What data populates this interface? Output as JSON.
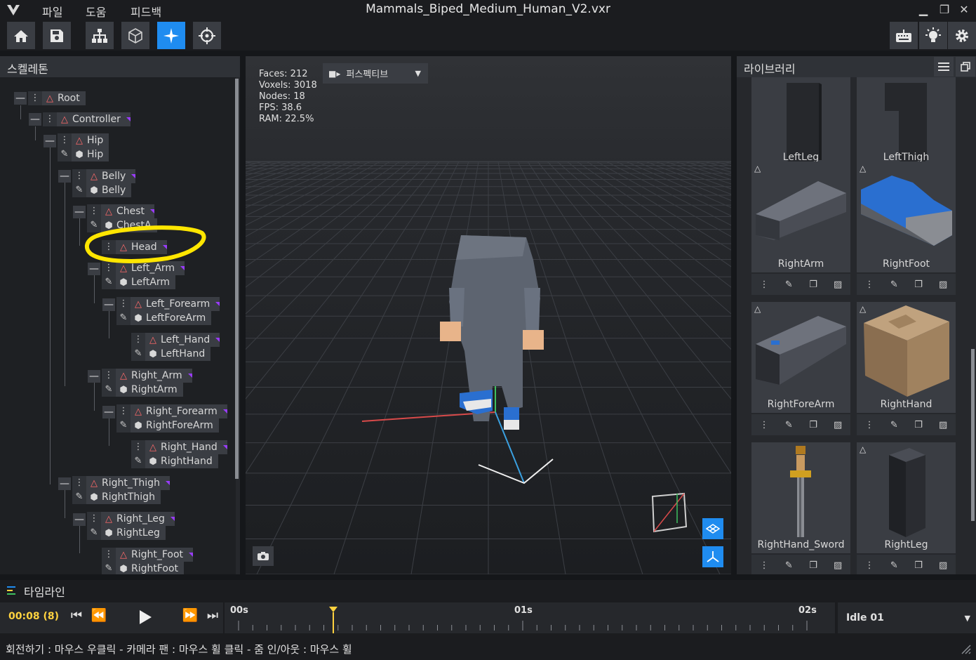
{
  "app": {
    "title": "Mammals_Biped_Medium_Human_V2.vxr",
    "menu": [
      "파일",
      "도움",
      "피드백"
    ]
  },
  "toolbar": {
    "left_icons": [
      "home-icon",
      "save-icon",
      "hierarchy-icon",
      "cube-icon",
      "sparkle-icon",
      "crosshair-icon"
    ],
    "active": "sparkle-icon",
    "right_icons": [
      "keyboard-icon",
      "lightbulb-icon",
      "gear-icon"
    ]
  },
  "skeleton": {
    "title": "스켈레톤",
    "nodes": [
      {
        "bone": "Root"
      },
      {
        "bone": "Controller"
      },
      {
        "bone": "Hip",
        "voxel": "Hip"
      },
      {
        "bone": "Belly",
        "voxel": "Belly"
      },
      {
        "bone": "Chest",
        "voxel": "ChestA"
      },
      {
        "bone": "Head"
      },
      {
        "bone": "Left_Arm",
        "voxel": "LeftArm"
      },
      {
        "bone": "Left_Forearm",
        "voxel": "LeftForeArm"
      },
      {
        "bone": "Left_Hand",
        "voxel": "LeftHand"
      },
      {
        "bone": "Right_Arm",
        "voxel": "RightArm"
      },
      {
        "bone": "Right_Forearm",
        "voxel": "RightForeArm"
      },
      {
        "bone": "Right_Hand",
        "voxel": "RightHand"
      },
      {
        "bone": "Right_Thigh",
        "voxel": "RightThigh"
      },
      {
        "bone": "Right_Leg",
        "voxel": "RightLeg"
      },
      {
        "bone": "Right_Foot",
        "voxel": "RightFoot"
      }
    ]
  },
  "viewport": {
    "stats": {
      "faces": "Faces: 212",
      "voxels": "Voxels: 3018",
      "nodes": "Nodes: 18",
      "fps": "FPS: 38.6",
      "ram": "RAM: 22.5%"
    },
    "camera_mode": "퍼스펙티브"
  },
  "library": {
    "title": "라이브러리",
    "items": [
      "LeftLeg",
      "LeftThigh",
      "RightArm",
      "RightFoot",
      "RightForeArm",
      "RightHand",
      "RightHand_Sword",
      "RightLeg"
    ]
  },
  "timeline": {
    "title": "타임라인",
    "current_time": "00:08 (8)",
    "ticks": [
      "00s",
      "01s",
      "02s"
    ],
    "animation": "Idle 01"
  },
  "status": {
    "hint": "회전하기 : 마우스 우클릭 - 카메라 팬 : 마우스 휠 클릭 - 줌 인/아웃 : 마우스 휠"
  },
  "colors": {
    "accent": "#1f8cf0",
    "bone": "#ff6a6a",
    "marker": "#ffd23f",
    "highlight": "#ffe600"
  }
}
